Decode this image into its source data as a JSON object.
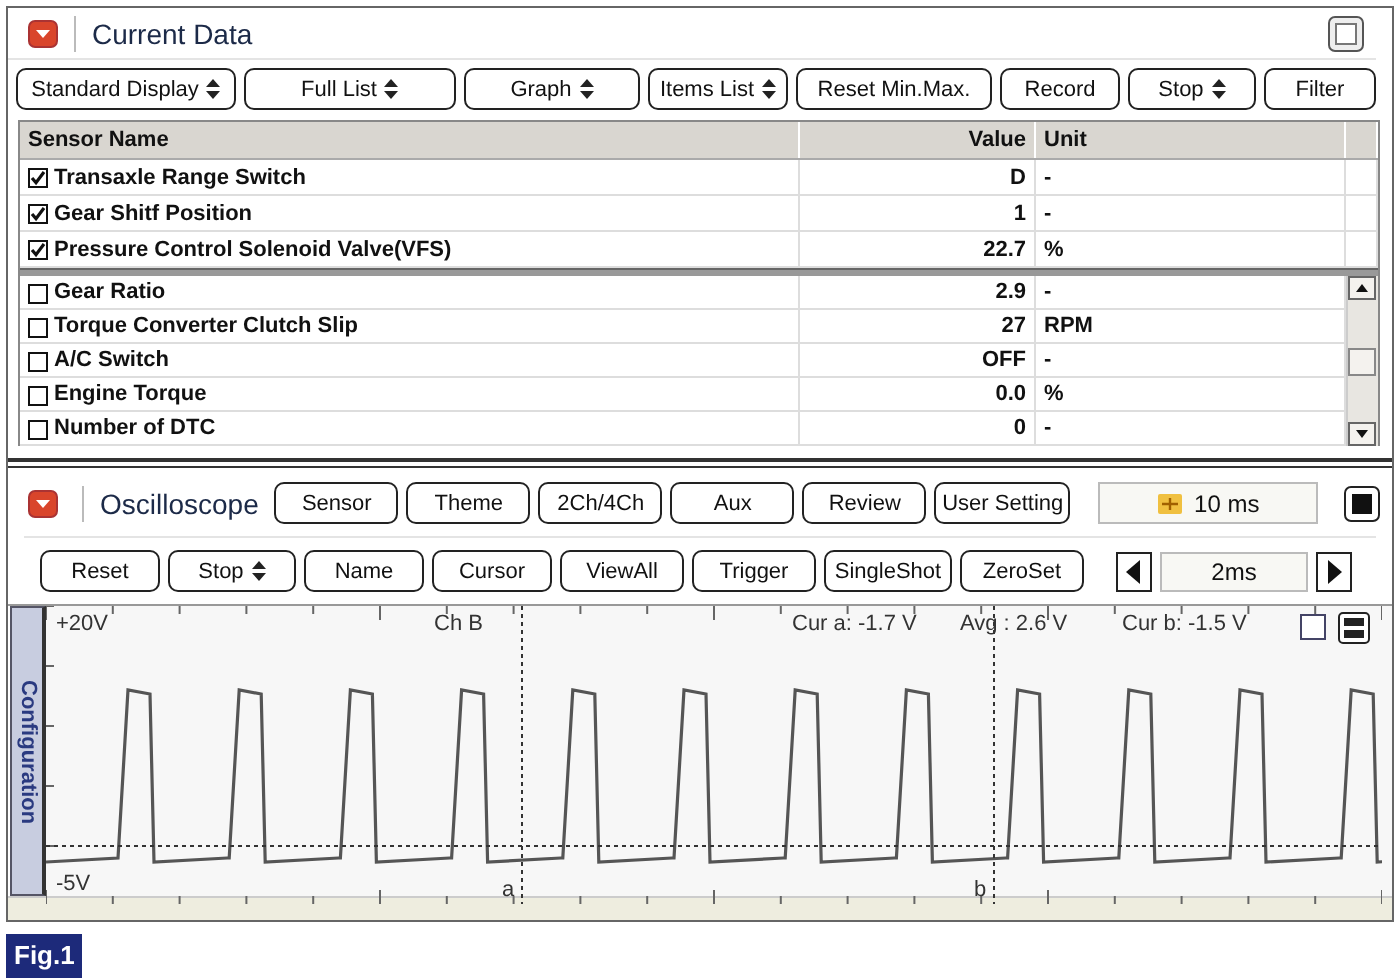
{
  "current_data": {
    "title": "Current Data",
    "toolbar": [
      {
        "label": "Standard Display",
        "kind": "dropdown"
      },
      {
        "label": "Full List",
        "kind": "dropdown"
      },
      {
        "label": "Graph",
        "kind": "dropdown"
      },
      {
        "label": "Items List",
        "kind": "dropdown"
      },
      {
        "label": "Reset Min.Max.",
        "kind": "button"
      },
      {
        "label": "Record",
        "kind": "button"
      },
      {
        "label": "Stop",
        "kind": "dropdown"
      },
      {
        "label": "Filter",
        "kind": "button"
      }
    ],
    "table": {
      "columns": [
        "Sensor Name",
        "Value",
        "Unit"
      ],
      "pinned_rows": [
        {
          "name": "Transaxle Range Switch",
          "value": "D",
          "unit": "-",
          "checked": true
        },
        {
          "name": "Gear Shitf Position",
          "value": "1",
          "unit": "-",
          "checked": true
        },
        {
          "name": "Pressure Control Solenoid Valve(VFS)",
          "value": "22.7",
          "unit": "%",
          "checked": true
        }
      ],
      "rows": [
        {
          "name": "Gear Ratio",
          "value": "2.9",
          "unit": "-",
          "checked": false
        },
        {
          "name": "Torque Converter Clutch Slip",
          "value": "27",
          "unit": "RPM",
          "checked": false
        },
        {
          "name": "A/C Switch",
          "value": "OFF",
          "unit": "-",
          "checked": false
        },
        {
          "name": "Engine Torque",
          "value": "0.0",
          "unit": "%",
          "checked": false
        },
        {
          "name": "Number of DTC",
          "value": "0",
          "unit": "-",
          "checked": false
        }
      ]
    }
  },
  "oscilloscope": {
    "title": "Oscilloscope",
    "toolbar": [
      "Sensor",
      "Theme",
      "2Ch/4Ch",
      "Aux",
      "Review",
      "User Setting"
    ],
    "timebase": "10 ms",
    "controls": [
      {
        "label": "Reset",
        "kind": "button"
      },
      {
        "label": "Stop",
        "kind": "dropdown"
      },
      {
        "label": "Name",
        "kind": "button"
      },
      {
        "label": "Cursor",
        "kind": "button"
      },
      {
        "label": "ViewAll",
        "kind": "button"
      },
      {
        "label": "Trigger",
        "kind": "button"
      },
      {
        "label": "SingleShot",
        "kind": "button"
      },
      {
        "label": "ZeroSet",
        "kind": "button"
      }
    ],
    "time_div": "2ms",
    "scope": {
      "side_tab": "Configuration",
      "top_label": "+20V",
      "bottom_label": "-5V",
      "channel": "Ch B",
      "readouts": [
        "Cur a: -1.7 V",
        "Avg : 2.6 V",
        "Cur b: -1.5 V"
      ],
      "cursor_labels": [
        "a",
        "b"
      ],
      "checked": false
    }
  },
  "caption": "Fig.1"
}
